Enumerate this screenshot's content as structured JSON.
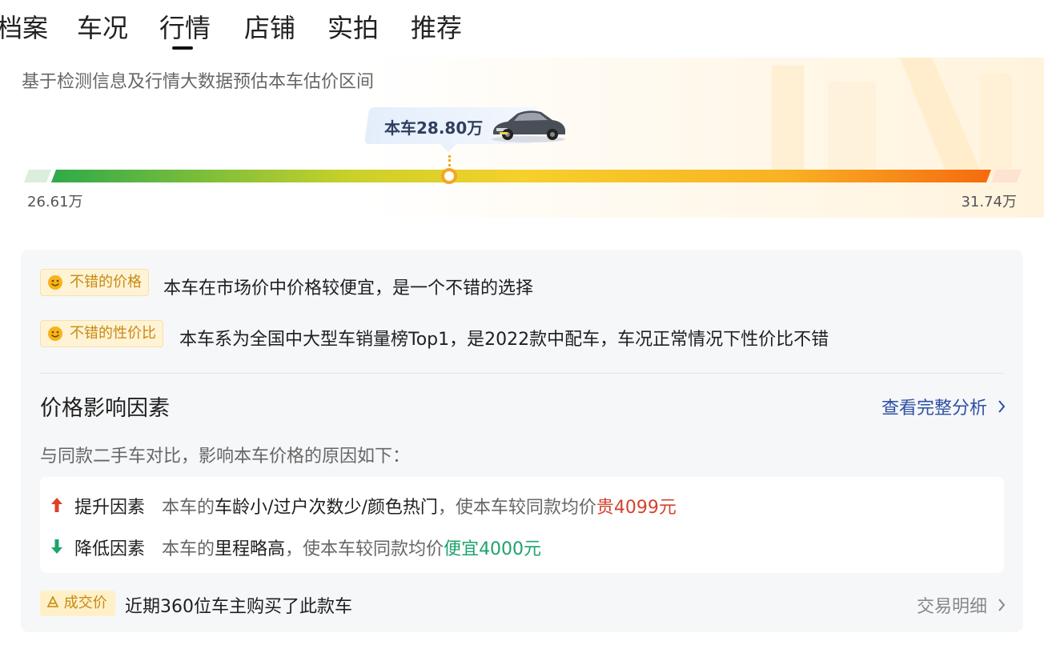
{
  "tabs": [
    {
      "label": "档案"
    },
    {
      "label": "车况"
    },
    {
      "label": "行情",
      "active": true
    },
    {
      "label": "店铺"
    },
    {
      "label": "实拍"
    },
    {
      "label": "推荐"
    }
  ],
  "estimate": {
    "subtitle": "基于检测信息及行情大数据预估本车估价区间",
    "price_label": "本车28.80万",
    "min_label": "26.61万",
    "max_label": "31.74万",
    "position_fraction": 0.41
  },
  "highlights": [
    {
      "tag": "不错的价格",
      "text": "本车在市场价中价格较便宜，是一个不错的选择"
    },
    {
      "tag": "不错的性价比",
      "text": "本车系为全国中大型车销量榜Top1，是2022款中配车，车况正常情况下性价比不错"
    }
  ],
  "factors_section": {
    "title": "价格影响因素",
    "link": "查看完整分析",
    "description": "与同款二手车对比，影响本车价格的原因如下：",
    "up": {
      "label": "提升因素",
      "prefix": "本车的",
      "items": "车龄小/过户次数少/颜色热门",
      "middle": "，使本车较同款均价",
      "result": "贵4099元"
    },
    "down": {
      "label": "降低因素",
      "prefix": "本车的",
      "items": "里程略高",
      "middle": "，使本车较同款均价",
      "result": "便宜4000元"
    }
  },
  "deals": {
    "tag": "成交价",
    "text": "近期360位车主购买了此款车",
    "link": "交易明细"
  },
  "colors": {
    "accent_orange": "#f5a623",
    "link_blue": "#2e4fa3",
    "up_red": "#d2432f",
    "down_green": "#1ea36b"
  }
}
